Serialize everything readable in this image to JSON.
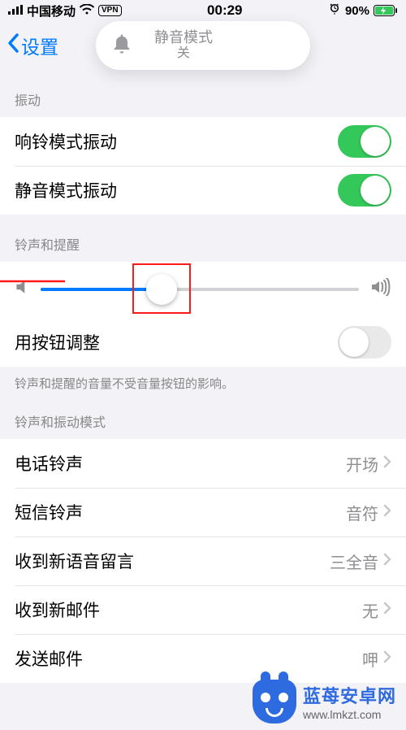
{
  "status_bar": {
    "carrier": "中国移动",
    "vpn": "VPN",
    "time": "00:29",
    "battery_pct": "90%"
  },
  "nav": {
    "back_label": "设置"
  },
  "banner": {
    "title": "静音模式",
    "sub": "关"
  },
  "section_vibrate": {
    "header": "振动",
    "ring_vibrate": "响铃模式振动",
    "silent_vibrate": "静音模式振动"
  },
  "section_ringer": {
    "header": "铃声和提醒",
    "change_with_buttons": "用按钮调整",
    "footer": "铃声和提醒的音量不受音量按钮的影响。"
  },
  "section_patterns": {
    "header": "铃声和振动模式",
    "rows": [
      {
        "label": "电话铃声",
        "value": "开场"
      },
      {
        "label": "短信铃声",
        "value": "音符"
      },
      {
        "label": "收到新语音留言",
        "value": "三全音"
      },
      {
        "label": "收到新邮件",
        "value": "无"
      },
      {
        "label": "发送邮件",
        "value": "呷"
      }
    ]
  },
  "watermark": {
    "name": "蓝苺安卓网",
    "url": "www.lmkzt.com"
  }
}
